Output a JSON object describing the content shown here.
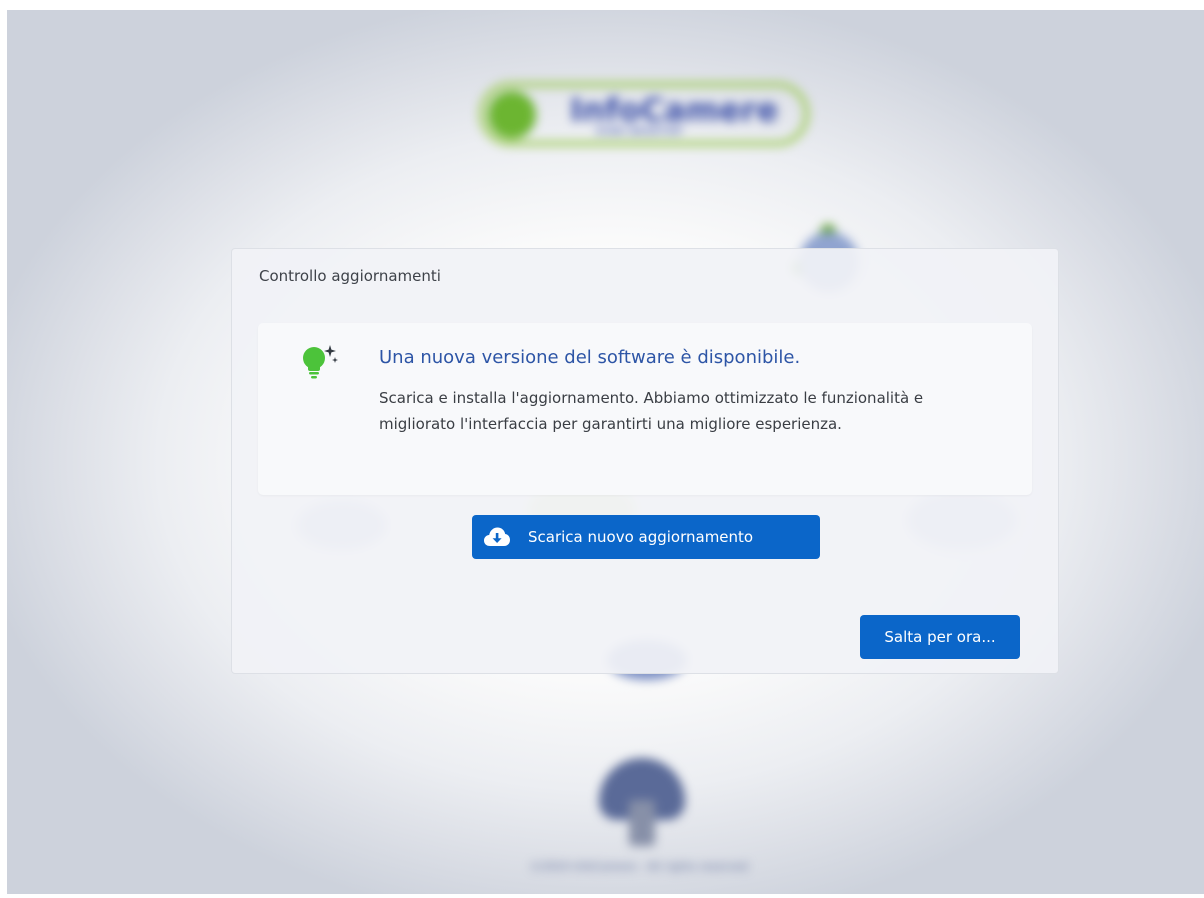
{
  "background": {
    "logo_text": "InfoCamere",
    "logo_subtitle": "SIGN DESKTOP",
    "footer": "©2024 InfoCamere - All rights reserved"
  },
  "dialog": {
    "title": "Controllo aggiornamenti",
    "notice": {
      "icon": "lightbulb-sparkle-icon",
      "heading": "Una nuova versione del software è disponibile.",
      "body": "Scarica e installa l'aggiornamento. Abbiamo ottimizzato le funzionalità e migliorato l'interfaccia per garantirti una migliore esperienza."
    },
    "download_button": {
      "label": "Scarica nuovo aggiornamento",
      "icon": "cloud-download-icon"
    },
    "skip_button": {
      "label": "Salta per ora..."
    }
  },
  "colors": {
    "primary": "#0b66c9",
    "heading": "#2d55a6",
    "icon_green": "#4cc33a",
    "logo_green": "#6cb531",
    "logo_blue": "#3b4fa8"
  }
}
